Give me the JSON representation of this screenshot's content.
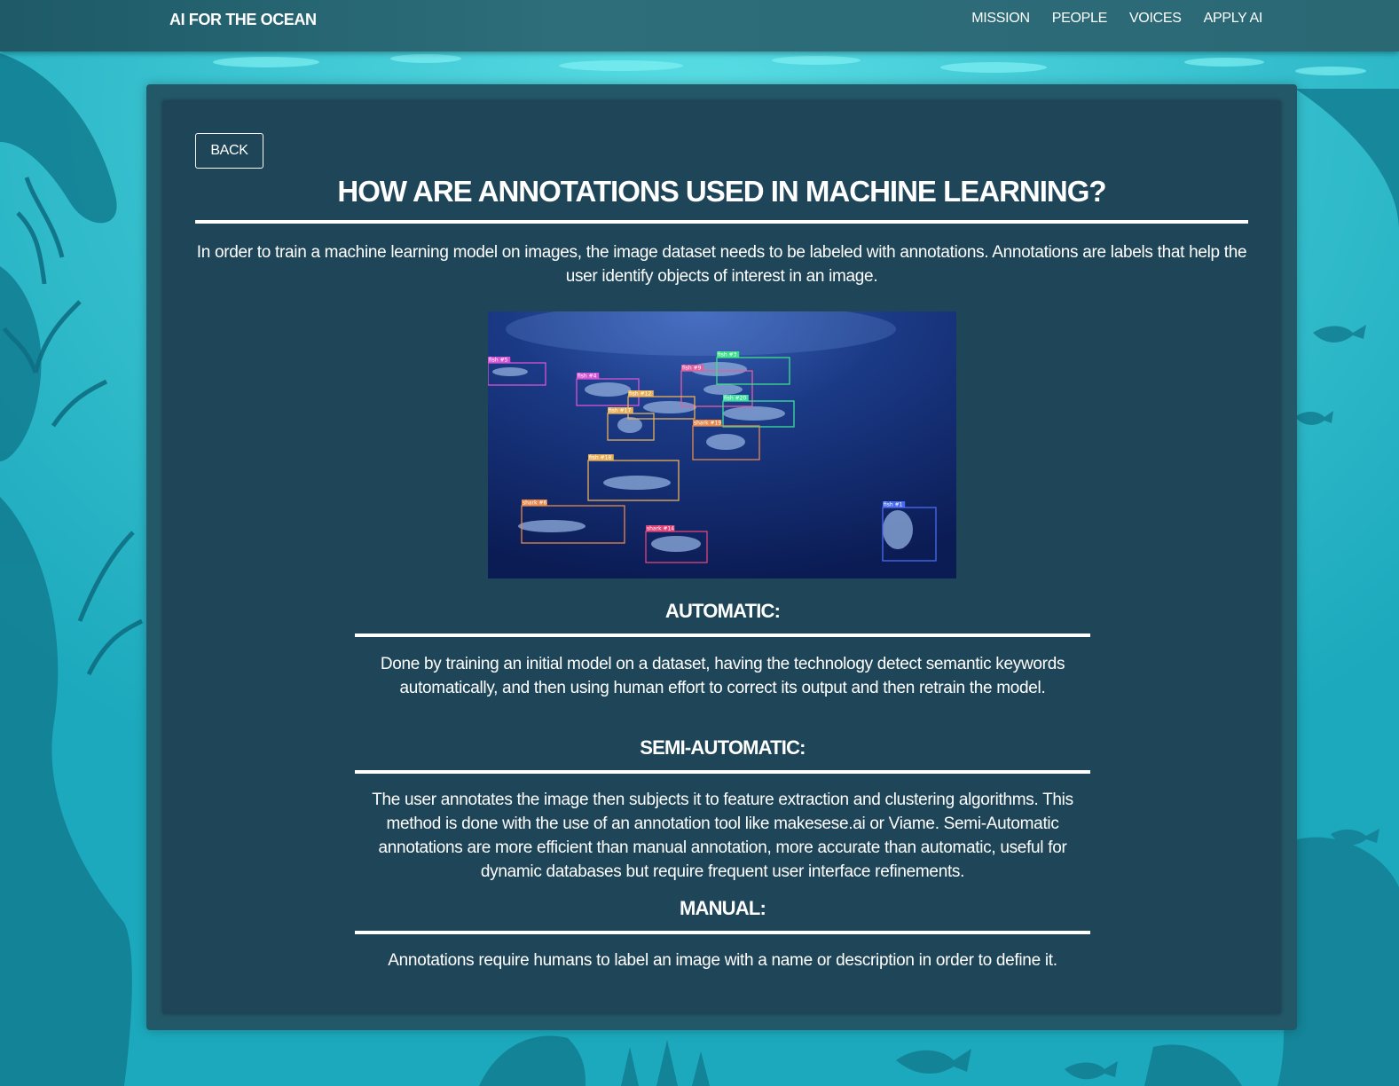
{
  "nav": {
    "brand": "AI FOR THE OCEAN",
    "links": [
      "MISSION",
      "PEOPLE",
      "VOICES",
      "APPLY AI"
    ]
  },
  "back_label": "BACK",
  "title": "HOW ARE ANNOTATIONS USED IN MACHINE LEARNING?",
  "intro": "In order to train a machine learning model on images, the image dataset needs to be labeled with annotations. Annotations are labels that help the user identify objects of interest in an image.",
  "image": {
    "boxes": [
      {
        "label": "fish #5",
        "color": "#d455d4"
      },
      {
        "label": "fish #4",
        "color": "#d455d4"
      },
      {
        "label": "fish #9",
        "color": "#e05fa0"
      },
      {
        "label": "fish #3",
        "color": "#3fe08a"
      },
      {
        "label": "fish #12",
        "color": "#e8b05a"
      },
      {
        "label": "fish #20",
        "color": "#3fe0a0"
      },
      {
        "label": "fish #17",
        "color": "#e8b05a"
      },
      {
        "label": "shark #19",
        "color": "#e8884a"
      },
      {
        "label": "fish #18",
        "color": "#e8b05a"
      },
      {
        "label": "shark #6",
        "color": "#e8884a"
      },
      {
        "label": "shark #14",
        "color": "#e0457a"
      },
      {
        "label": "fish #1",
        "color": "#4a6cf0"
      }
    ]
  },
  "sections": [
    {
      "heading": "AUTOMATIC:",
      "body": "Done by training an initial model on a dataset, having the technology detect semantic keywords automatically, and then using human effort to correct its output and then retrain the model."
    },
    {
      "heading": "SEMI-AUTOMATIC:",
      "body": "The user annotates the image then subjects it to feature extraction and clustering algorithms. This method is done with the use of an annotation tool like makesese.ai or Viame. Semi-Automatic annotations are more efficient than manual annotation, more accurate than automatic, useful for dynamic databases but require frequent user interface refinements."
    },
    {
      "heading": "MANUAL:",
      "body": "Annotations require humans to label an image with a name or description in order to define it."
    }
  ]
}
